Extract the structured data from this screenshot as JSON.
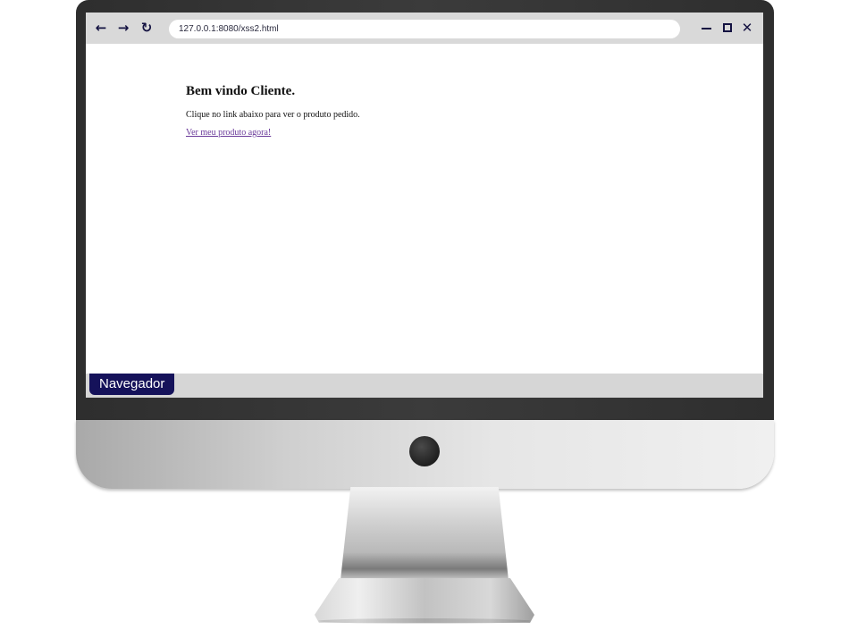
{
  "browser": {
    "url": "127.0.0.1:8080/xss2.html",
    "icons": {
      "back": "arrow-left-icon",
      "forward": "arrow-right-icon",
      "reload": "reload-icon",
      "minimize": "minimize-icon",
      "maximize": "maximize-icon",
      "close": "close-icon"
    },
    "glyphs": {
      "back": "←",
      "forward": "→",
      "reload": "↻",
      "close": "✕"
    }
  },
  "page": {
    "heading": "Bem vindo Cliente.",
    "paragraph": "Clique no link abaixo para ver o produto pedido.",
    "link_text": "Ver meu produto agora!"
  },
  "footer": {
    "label": "Navegador"
  },
  "colors": {
    "accent": "#15125a",
    "link": "#6a3a9a",
    "toolbar": "#d9d9d9",
    "bezel": "#333333"
  }
}
